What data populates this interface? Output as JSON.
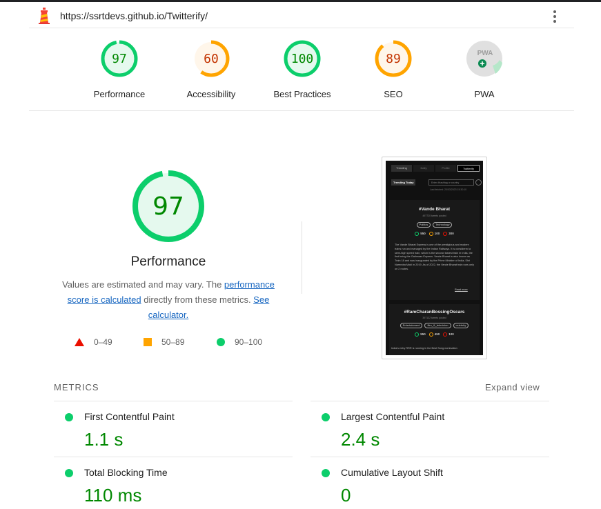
{
  "topbar": {
    "url": "https://ssrtdevs.github.io/Twitterify/"
  },
  "colors": {
    "pass": "#0cce6b",
    "pass_text": "#008800",
    "average": "#ffa400",
    "average_text": "#c33300",
    "fail": "#eb0f00",
    "link": "#1565c0"
  },
  "categories": [
    {
      "label": "Performance",
      "score": "97",
      "rating": "pass"
    },
    {
      "label": "Accessibility",
      "score": "60",
      "rating": "average"
    },
    {
      "label": "Best Practices",
      "score": "100",
      "rating": "pass"
    },
    {
      "label": "SEO",
      "score": "89",
      "rating": "average"
    },
    {
      "label": "PWA",
      "badge": "PWA",
      "rating": "pwa"
    }
  ],
  "performance": {
    "score": "97",
    "title": "Performance",
    "desc_prefix": "Values are estimated and may vary. The ",
    "desc_link1": "performance score is calculated",
    "desc_middle": " directly from these metrics. ",
    "desc_link2": "See calculator.",
    "legend": {
      "fail": "0–49",
      "average": "50–89",
      "pass": "90–100"
    }
  },
  "screenshot": {
    "nav": [
      "Trending",
      "Daily",
      "Profile",
      "Twitterify"
    ],
    "trending_button": "Trending Today",
    "search_placeholder": "Enter #hashtag or country",
    "last_fetched": "Last fetched: 20/03/2023 15:30:10",
    "card1": {
      "title": "#Vande Bharat",
      "sub": "497720 tweets posted",
      "tags": [
        "Politics",
        "Technology"
      ],
      "stats": [
        "550",
        "100",
        "300"
      ],
      "body": "The Vande Bharat Express is one of the prestigious and modern trains run and managed by the Indian Railways. It is considered a semi-high speed train, which is the second fastest train in India, the first being the Gatimaan Express. Vande Bharat is also known as Train 18 and was inaugurated by the Prime Minister of India, Shri Narendra Modi in 2019. As of 2022, the Vande Bharat train runs only on 2 routes.",
      "read_more": "Read more"
    },
    "card2": {
      "title": "#RamCharanBossingOscars",
      "sub": "397132 tweets posted",
      "tags": [
        "Entertainment",
        "film_&_television",
        "celebrity"
      ],
      "stats": [
        "550",
        "450",
        "100"
      ],
      "body": "India's entry RRR is running in the Best Song nomination"
    }
  },
  "metrics": {
    "header": "METRICS",
    "expand": "Expand view",
    "items": [
      {
        "name": "First Contentful Paint",
        "value": "1.1 s"
      },
      {
        "name": "Largest Contentful Paint",
        "value": "2.4 s"
      },
      {
        "name": "Total Blocking Time",
        "value": "110 ms"
      },
      {
        "name": "Cumulative Layout Shift",
        "value": "0"
      }
    ]
  }
}
